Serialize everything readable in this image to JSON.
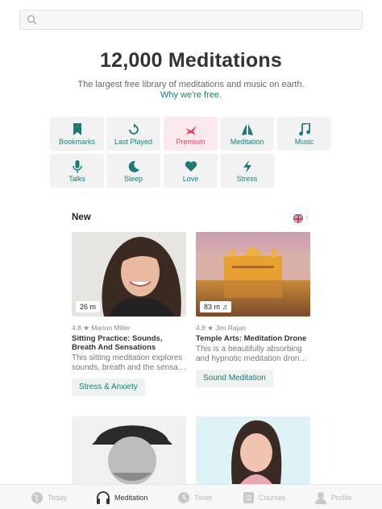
{
  "search": {
    "placeholder": "",
    "value": ""
  },
  "header": {
    "title": "12,000 Meditations",
    "subtitle": "The largest free library of meditations and music on earth.",
    "link": "Why we're free."
  },
  "categories": [
    {
      "label": "Bookmarks",
      "icon": "bookmark-icon"
    },
    {
      "label": "Last Played",
      "icon": "replay-icon"
    },
    {
      "label": "Premium",
      "icon": "bird-icon"
    },
    {
      "label": "Meditation",
      "icon": "praying-hands-icon"
    },
    {
      "label": "Music",
      "icon": "music-note-icon"
    },
    {
      "label": "Talks",
      "icon": "microphone-icon"
    },
    {
      "label": "Sleep",
      "icon": "moon-icon"
    },
    {
      "label": "Love",
      "icon": "heart-icon"
    },
    {
      "label": "Stress",
      "icon": "lightning-icon"
    }
  ],
  "new_section": {
    "label": "New",
    "cards": [
      {
        "duration": "26 m",
        "rating": "4.8",
        "author": "Marion Miller",
        "title": "Sitting Practice: Sounds, Breath And Sensations",
        "description": "This sitting meditation explores sounds, breath and the sensa…",
        "tag": "Stress & Anxiety"
      },
      {
        "duration": "83 m",
        "rating": "4.8",
        "author": "Jim Rajan",
        "title": "Temple Arts: Meditation Drone",
        "description": "This is a beautifully absorbing and hypnotic meditation dron…",
        "tag": "Sound Meditation"
      }
    ]
  },
  "tabbar": [
    {
      "label": "Today",
      "icon": "globe-icon",
      "active": false
    },
    {
      "label": "Meditation",
      "icon": "headphones-icon",
      "active": true
    },
    {
      "label": "Timer",
      "icon": "clock-icon",
      "active": false
    },
    {
      "label": "Courses",
      "icon": "course-icon",
      "active": false
    },
    {
      "label": "Profile",
      "icon": "profile-icon",
      "active": false
    }
  ],
  "colors": {
    "accent": "#1f7a76",
    "premium": "#e0456c",
    "background": "#ffffff"
  }
}
